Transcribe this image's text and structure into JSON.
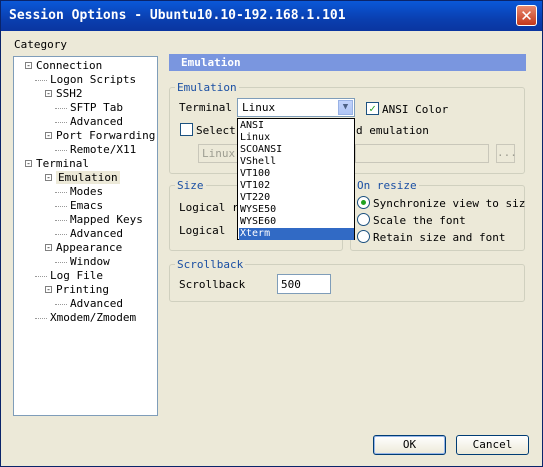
{
  "window": {
    "title": "Session Options - Ubuntu10.10-192.168.1.101",
    "close_glyph": "✕"
  },
  "category_label": "Category",
  "tree": [
    {
      "label": "Connection",
      "toggle": "-"
    },
    {
      "label": "Logon Scripts",
      "toggle": ""
    },
    {
      "label": "SSH2",
      "toggle": "-"
    },
    {
      "label": "SFTP Tab",
      "toggle": ""
    },
    {
      "label": "Advanced",
      "toggle": ""
    },
    {
      "label": "Port Forwarding",
      "toggle": "-"
    },
    {
      "label": "Remote/X11",
      "toggle": ""
    },
    {
      "label": "Terminal",
      "toggle": "-"
    },
    {
      "label": "Emulation",
      "toggle": "-",
      "selected": true
    },
    {
      "label": "Modes",
      "toggle": ""
    },
    {
      "label": "Emacs",
      "toggle": ""
    },
    {
      "label": "Mapped Keys",
      "toggle": ""
    },
    {
      "label": "Advanced",
      "toggle": ""
    },
    {
      "label": "Appearance",
      "toggle": "-"
    },
    {
      "label": "Window",
      "toggle": ""
    },
    {
      "label": "Log File",
      "toggle": ""
    },
    {
      "label": "Printing",
      "toggle": "-"
    },
    {
      "label": "Advanced",
      "toggle": ""
    },
    {
      "label": "Xmodem/Zmodem",
      "toggle": ""
    }
  ],
  "panel": {
    "header": "Emulation",
    "emulation_group": "Emulation",
    "terminal_label": "Terminal",
    "terminal_value": "Linux",
    "ansi_color_label": "ANSI Color",
    "ansi_color_checked": true,
    "select_label": "Select",
    "select_suffix": "d emulation",
    "select_checked": false,
    "disabled_value": "Linux",
    "browse_label": "...",
    "size_group": "Size",
    "logical_rows_label": "Logical r",
    "logical_cols_label": "Logical",
    "on_resize_group": "On resize",
    "resize_options": [
      {
        "label": "Synchronize view to siz",
        "checked": true
      },
      {
        "label": "Scale the font",
        "checked": false
      },
      {
        "label": "Retain size and font",
        "checked": false
      }
    ],
    "scrollback_group": "Scrollback",
    "scrollback_label": "Scrollback",
    "scrollback_value": "500"
  },
  "dropdown": {
    "options": [
      "ANSI",
      "Linux",
      "SCOANSI",
      "VShell",
      "VT100",
      "VT102",
      "VT220",
      "WYSE50",
      "WYSE60",
      "Xterm"
    ],
    "selected": "Xterm"
  },
  "buttons": {
    "ok": "OK",
    "cancel": "Cancel"
  },
  "colors": {
    "title_bar": "#0a4fc8",
    "header": "#7a96df",
    "selection": "#316ac5",
    "group_title": "#1a4fa3"
  }
}
